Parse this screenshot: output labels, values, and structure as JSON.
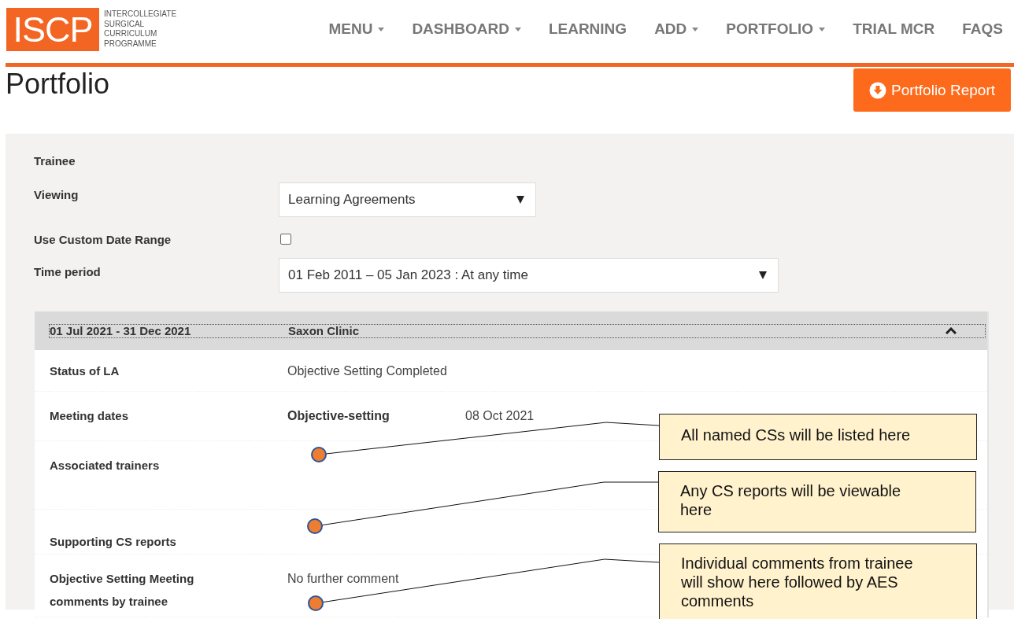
{
  "header": {
    "logo": {
      "mark": "ISCP",
      "lines": [
        "INTERCOLLEGIATE",
        "SURGICAL",
        "CURRICULUM",
        "PROGRAMME"
      ]
    },
    "nav": [
      {
        "label": "MENU",
        "dropdown": true
      },
      {
        "label": "DASHBOARD",
        "dropdown": true
      },
      {
        "label": "LEARNING",
        "dropdown": false
      },
      {
        "label": "ADD",
        "dropdown": true
      },
      {
        "label": "PORTFOLIO",
        "dropdown": true
      },
      {
        "label": "TRIAL MCR",
        "dropdown": false
      },
      {
        "label": "FAQS",
        "dropdown": false
      }
    ]
  },
  "page_title": "Portfolio",
  "report_button": "Portfolio Report",
  "filters": [
    {
      "kind": "text",
      "label": "Trainee"
    },
    {
      "kind": "select",
      "label": "Viewing",
      "value": "Learning Agreements"
    },
    {
      "kind": "checkbox",
      "label": "Use Custom Date Range",
      "checked": false
    },
    {
      "kind": "select",
      "label": "Time period",
      "value": "01 Feb 2011 – 05 Jan 2023 : At any time"
    }
  ],
  "agreement": {
    "date_range": "01 Jul 2021 - 31 Dec 2021",
    "location": "Saxon Clinic",
    "expanded": true,
    "rows": [
      {
        "kind": "text",
        "label": "Status of LA",
        "value": "Objective Setting Completed"
      },
      {
        "kind": "meeting",
        "label": "Meeting dates",
        "meeting": "Objective-setting",
        "date": "08 Oct 2021"
      },
      {
        "kind": "empty",
        "label": "Associated trainers"
      },
      {
        "kind": "empty",
        "label": "Supporting CS reports"
      },
      {
        "kind": "text",
        "label": "Objective Setting Meeting comments by trainee",
        "value": "No further comment"
      }
    ]
  },
  "callouts": [
    {
      "text": "All named CSs will be listed here"
    },
    {
      "text": "Any CS reports will be viewable here"
    },
    {
      "text": "Individual comments from trainee will show here followed by AES comments"
    }
  ]
}
